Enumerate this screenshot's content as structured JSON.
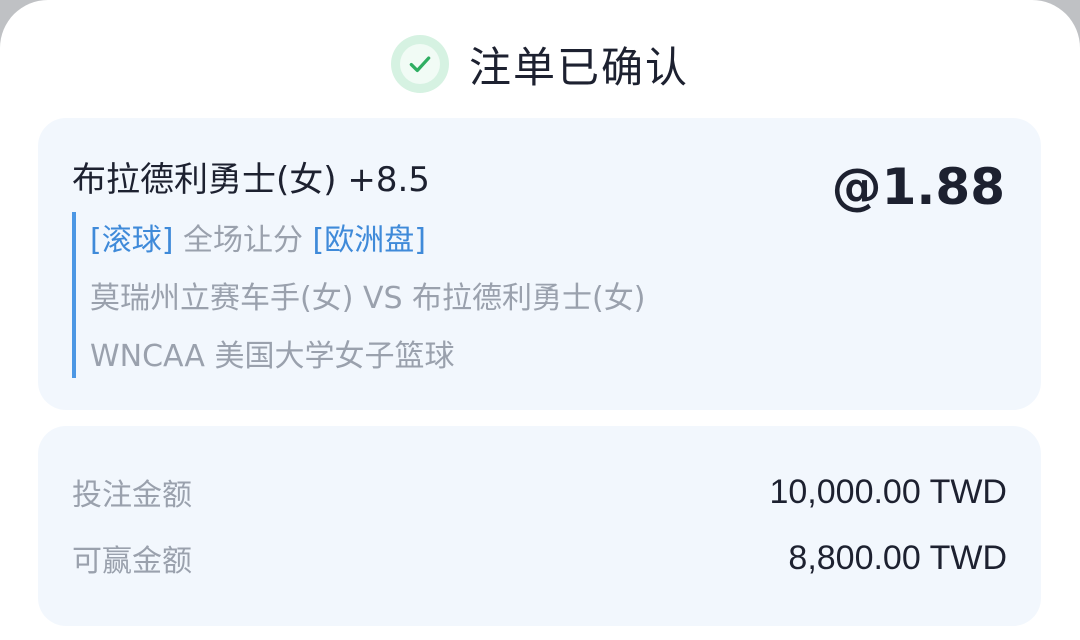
{
  "header": {
    "title": "注单已确认",
    "icon": "check-icon",
    "icon_color": "#2fae62"
  },
  "bet": {
    "selection": "布拉德利勇士(女) +8.5",
    "odds": "@1.88",
    "tag_live": "[滚球]",
    "market": "全场让分",
    "tag_odds_format": "[欧洲盘]",
    "match": "莫瑞州立赛车手(女) VS 布拉德利勇士(女)",
    "league": "WNCAA 美国大学女子篮球"
  },
  "amounts": {
    "rows": [
      {
        "label": "投注金额",
        "value": "10,000.00 TWD"
      },
      {
        "label": "可赢金额",
        "value": "8,800.00 TWD"
      }
    ]
  },
  "colors": {
    "accent": "#4c97e4",
    "card_background": "#f2f7fd",
    "success": "#2fae62"
  }
}
